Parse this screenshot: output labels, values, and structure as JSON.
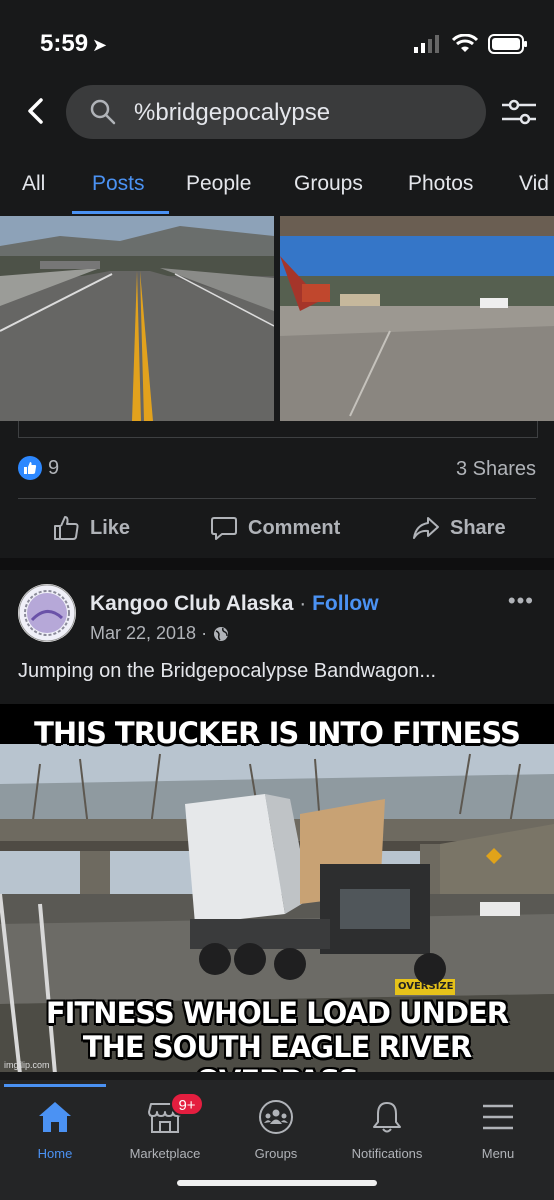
{
  "status_bar": {
    "time": "5:59"
  },
  "search": {
    "query": "%bridgepocalypse"
  },
  "tabs": [
    {
      "label": "All"
    },
    {
      "label": "Posts"
    },
    {
      "label": "People"
    },
    {
      "label": "Groups"
    },
    {
      "label": "Photos"
    },
    {
      "label": "Vid"
    }
  ],
  "active_tab": "Posts",
  "post1": {
    "like_count": "9",
    "shares": "3 Shares",
    "actions": {
      "like": "Like",
      "comment": "Comment",
      "share": "Share"
    }
  },
  "post2": {
    "author": "Kangoo Club Alaska",
    "separator": "·",
    "follow_label": "Follow",
    "date": "Mar 22, 2018 ·",
    "text": "Jumping on the Bridgepocalypse Bandwagon...",
    "more": "•••",
    "meme_top": "THIS TRUCKER IS INTO FITNESS",
    "meme_bottom_1": "FITNESS WHOLE LOAD UNDER",
    "meme_bottom_2": "THE SOUTH EAGLE RIVER OVERPASS",
    "watermark": "imgflip.com",
    "truck_sign": "OVERSIZE"
  },
  "bottom_nav": [
    {
      "label": "Home",
      "icon": "home-icon"
    },
    {
      "label": "Marketplace",
      "icon": "marketplace-icon",
      "badge": "9+"
    },
    {
      "label": "Groups",
      "icon": "groups-icon"
    },
    {
      "label": "Notifications",
      "icon": "bell-icon"
    },
    {
      "label": "Menu",
      "icon": "menu-icon"
    }
  ],
  "colors": {
    "accent": "#4b92f3",
    "background": "#18191a",
    "badge": "#e41e3f"
  }
}
